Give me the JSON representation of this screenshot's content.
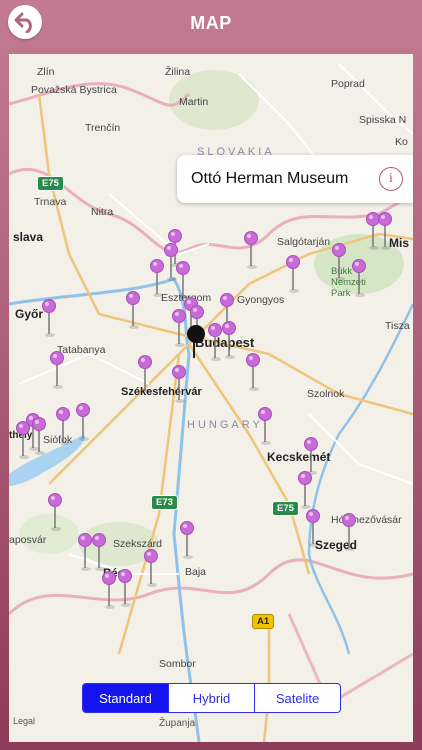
{
  "header": {
    "title": "MAP",
    "back_icon": "back-arrow-icon"
  },
  "callout": {
    "text": "Ottó Herman Museum",
    "info_icon": "info-icon"
  },
  "map": {
    "labels": {
      "zlin": "Zlín",
      "zilina": "Žilina",
      "poprad": "Poprad",
      "povazska": "Považská Bystrica",
      "martin": "Martin",
      "spisska": "Spisska N",
      "ko": "Ko",
      "trencin": "Trenčín",
      "slovakia": "SLOVAKIA",
      "trnava": "Trnava",
      "nitra": "Nitra",
      "slava": "slava",
      "salgotarjan": "Salgótarján",
      "mis": "Mis",
      "bukk": "Bükk Nemzeti Park",
      "esztergom": "Esztergom",
      "gyongyos": "Gyongyos",
      "gyor": "Győr",
      "tatabanya": "Tatabanya",
      "budapest": "Budapest",
      "tisz": "Tisza",
      "szekesfehervar": "Székesfehérvár",
      "szolnok": "Szolnok",
      "hungary": "HUNGARY",
      "siofok": "Siófok",
      "kecskemet": "Kecskemét",
      "thely": "thely",
      "hodmezo": "Hódmezővásár",
      "kaposvar": "aposvár",
      "szekszard": "Szekszárd",
      "szeged": "Szeged",
      "pecs": "Pécs",
      "baja": "Baja",
      "sombor": "Sombor",
      "zupanja": "Županja",
      "legal": "Legal"
    },
    "shields": {
      "e75_north": "E75",
      "e73": "E73",
      "e75_south": "E75",
      "a1": "A1"
    }
  },
  "segments": {
    "standard": "Standard",
    "hybrid": "Hybrid",
    "satellite": "Satelite",
    "active": "Standard"
  },
  "colors": {
    "header_bg": "#b0647e",
    "pin": "#c86ad8",
    "segment_accent": "#1414f0"
  }
}
